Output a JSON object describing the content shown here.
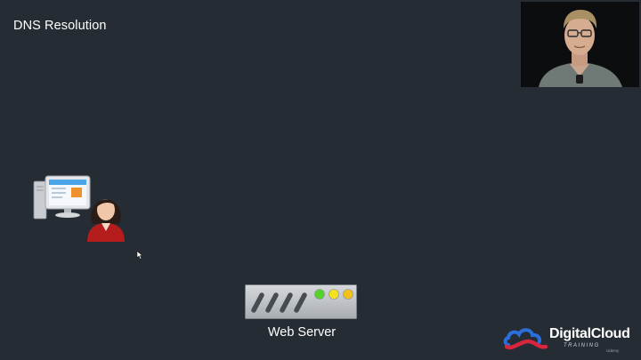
{
  "slide": {
    "title": "DNS Resolution"
  },
  "diagram": {
    "server_label": "Web Server",
    "server_leds": [
      "#55d22b",
      "#f2e11f",
      "#f2c21a"
    ]
  },
  "branding": {
    "logo_text": "DigitalCloud",
    "logo_subtext": "TRAINING",
    "watermark": "Udemy"
  },
  "colors": {
    "background": "#252c33",
    "logo_red": "#d7263d",
    "logo_blue": "#2a6fdb"
  },
  "icons": {
    "client": "user-workstation-icon",
    "server": "web-server-icon",
    "cursor": "mouse-pointer-icon",
    "presenter": "presenter-webcam"
  }
}
